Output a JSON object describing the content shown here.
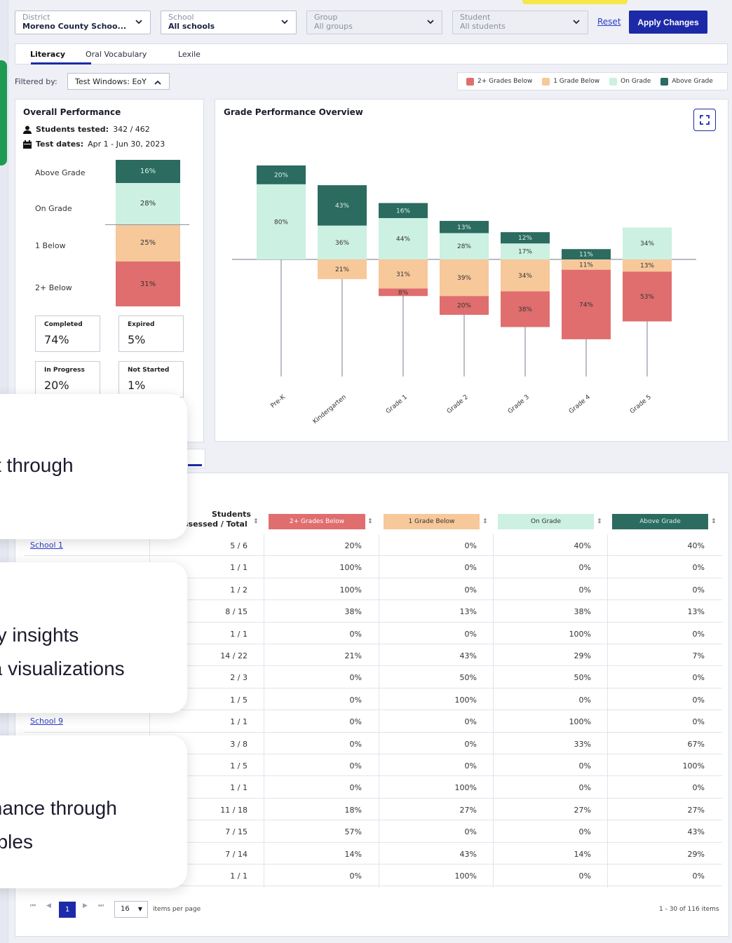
{
  "filters": {
    "district": {
      "label": "District",
      "value": "Moreno County Schoo..."
    },
    "school": {
      "label": "School",
      "value": "All schools"
    },
    "group": {
      "label": "Group",
      "value": "All groups"
    },
    "student": {
      "label": "Student",
      "value": "All students"
    },
    "reset_label": "Reset",
    "apply_label": "Apply Changes"
  },
  "tabs": [
    "Literacy",
    "Oral Vocabulary",
    "Lexile"
  ],
  "filtered_by": {
    "label": "Filtered by:",
    "value": "Test Windows: EoY"
  },
  "legend": [
    {
      "label": "2+ Grades Below",
      "color": "#e06e6e"
    },
    {
      "label": "1 Grade Below",
      "color": "#f7c89a"
    },
    {
      "label": "On Grade",
      "color": "#ccf0e2"
    },
    {
      "label": "Above Grade",
      "color": "#2b6b60"
    }
  ],
  "overall": {
    "title": "Overall Performance",
    "students_label": "Students tested:",
    "students_value": "342 / 462",
    "dates_label": "Test dates:",
    "dates_value": "Apr 1 - Jun 30, 2023",
    "stack": [
      {
        "label": "Above Grade",
        "pct": "16%",
        "color": "#2b6b60",
        "text": "#d9f1ea"
      },
      {
        "label": "On Grade",
        "pct": "28%",
        "color": "#ccf0e2",
        "text": "#333"
      },
      {
        "label": "1 Below",
        "pct": "25%",
        "color": "#f7c89a",
        "text": "#333"
      },
      {
        "label": "2+ Below",
        "pct": "31%",
        "color": "#e06e6e",
        "text": "#333"
      }
    ],
    "cards": [
      {
        "label": "Completed",
        "value": "74%"
      },
      {
        "label": "Expired",
        "value": "5%"
      },
      {
        "label": "In Progress",
        "value": "20%"
      },
      {
        "label": "Not Started",
        "value": "1%"
      }
    ]
  },
  "chart": {
    "title": "Grade Performance Overview",
    "colors": {
      "above": "#2b6b60",
      "on": "#ccf0e2",
      "one": "#f7c89a",
      "two": "#e06e6e"
    }
  },
  "chart_data": {
    "type": "bar",
    "categories": [
      "Pre-K",
      "Kindergarten",
      "Grade 1",
      "Grade 2",
      "Grade 3",
      "Grade 4",
      "Grade 5"
    ],
    "series": [
      {
        "name": "Above Grade",
        "values": [
          20,
          43,
          16,
          13,
          12,
          11,
          0
        ]
      },
      {
        "name": "On Grade",
        "values": [
          80,
          36,
          44,
          28,
          17,
          0,
          34
        ]
      },
      {
        "name": "1 Grade Below",
        "values": [
          0,
          21,
          31,
          39,
          34,
          11,
          13
        ]
      },
      {
        "name": "2+ Grades Below",
        "values": [
          0,
          0,
          8,
          20,
          38,
          74,
          53
        ]
      }
    ]
  },
  "popups": [
    {
      "text1": "st through"
    },
    {
      "text1": "ey insights",
      "text2": "ta visualizations"
    },
    {
      "text1": "mance through",
      "text2": "ables"
    }
  ],
  "table": {
    "headers": {
      "students": "Students",
      "students2": "ssessed / Total",
      "two": "2+ Grades Below",
      "one": "1 Grade Below",
      "on": "On Grade",
      "above": "Above Grade"
    },
    "rows": [
      {
        "school": "School 1",
        "assessed": "5 / 6",
        "two": "20%",
        "one": "0%",
        "on": "40%",
        "above": "40%"
      },
      {
        "school": "",
        "assessed": "1 / 1",
        "two": "100%",
        "one": "0%",
        "on": "0%",
        "above": "0%"
      },
      {
        "school": "",
        "assessed": "1 / 2",
        "two": "100%",
        "one": "0%",
        "on": "0%",
        "above": "0%"
      },
      {
        "school": "",
        "assessed": "8 / 15",
        "two": "38%",
        "one": "13%",
        "on": "38%",
        "above": "13%"
      },
      {
        "school": "",
        "assessed": "1 / 1",
        "two": "0%",
        "one": "0%",
        "on": "100%",
        "above": "0%"
      },
      {
        "school": "",
        "assessed": "14 / 22",
        "two": "21%",
        "one": "43%",
        "on": "29%",
        "above": "7%"
      },
      {
        "school": "",
        "assessed": "2 / 3",
        "two": "0%",
        "one": "50%",
        "on": "50%",
        "above": "0%"
      },
      {
        "school": "",
        "assessed": "1 / 5",
        "two": "0%",
        "one": "100%",
        "on": "0%",
        "above": "0%"
      },
      {
        "school": "School 9",
        "assessed": "1 / 1",
        "two": "0%",
        "one": "0%",
        "on": "100%",
        "above": "0%"
      },
      {
        "school": "",
        "assessed": "3 / 8",
        "two": "0%",
        "one": "0%",
        "on": "33%",
        "above": "67%"
      },
      {
        "school": "",
        "assessed": "1 / 5",
        "two": "0%",
        "one": "0%",
        "on": "0%",
        "above": "100%"
      },
      {
        "school": "",
        "assessed": "1 / 1",
        "two": "0%",
        "one": "100%",
        "on": "0%",
        "above": "0%"
      },
      {
        "school": "",
        "assessed": "11 / 18",
        "two": "18%",
        "one": "27%",
        "on": "27%",
        "above": "27%"
      },
      {
        "school": "",
        "assessed": "7 / 15",
        "two": "57%",
        "one": "0%",
        "on": "0%",
        "above": "43%"
      },
      {
        "school": "",
        "assessed": "7 / 14",
        "two": "14%",
        "one": "43%",
        "on": "14%",
        "above": "29%"
      },
      {
        "school": "",
        "assessed": "1 / 1",
        "two": "0%",
        "one": "100%",
        "on": "0%",
        "above": "0%"
      }
    ]
  },
  "pagination": {
    "current": "1",
    "per_page": "16",
    "per_page_label": "items per page",
    "summary": "1 - 30 of 116 items"
  }
}
